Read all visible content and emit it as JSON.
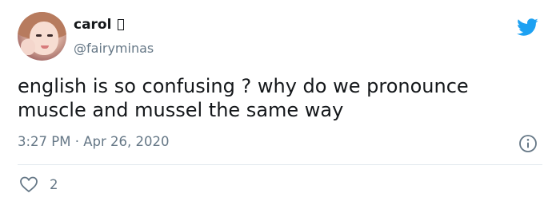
{
  "author": {
    "display_name": "carol",
    "handle": "@fairyminas"
  },
  "tweet": {
    "text": "english is so confusing ? why do we pronounce muscle and mussel the same way",
    "time": "3:27 PM",
    "separator": "·",
    "date": "Apr 26, 2020"
  },
  "actions": {
    "likes": "2"
  },
  "icons": {
    "brand": "twitter-bird-icon",
    "info": "info-icon",
    "like": "heart-icon"
  },
  "colors": {
    "brand_blue": "#1da1f2",
    "text": "#14171a",
    "secondary": "#657786",
    "divider": "#e1e8ed"
  }
}
